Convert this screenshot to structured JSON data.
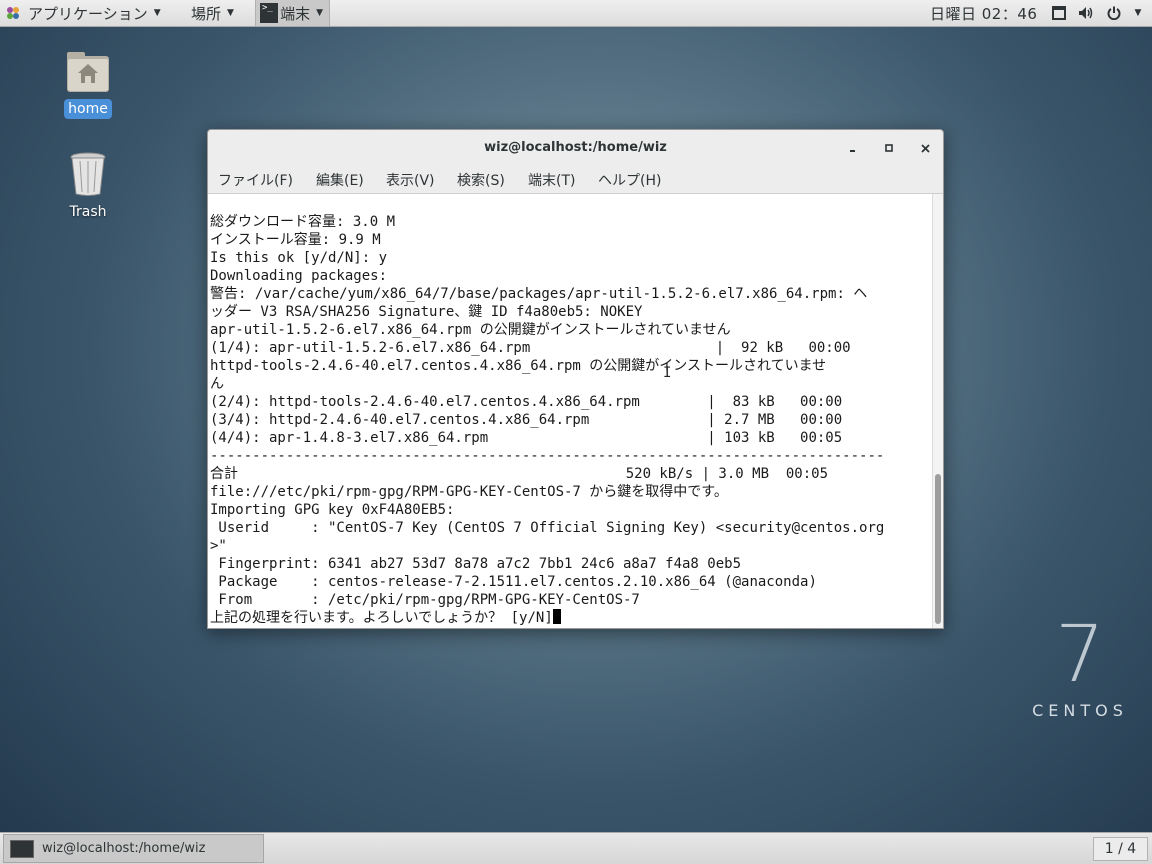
{
  "topbar": {
    "apps_label": "アプリケーション",
    "places_label": "場所",
    "active_app_label": "端末",
    "clock": "日曜日 02：46"
  },
  "desktop": {
    "home_label": "home",
    "trash_label": "Trash"
  },
  "window": {
    "title": "wiz@localhost:/home/wiz",
    "menu": [
      "ファイル(F)",
      "編集(E)",
      "表示(V)",
      "検索(S)",
      "端末(T)",
      "ヘルプ(H)"
    ],
    "lines": [
      "総ダウンロード容量: 3.0 M",
      "インストール容量: 9.9 M",
      "Is this ok [y/d/N]: y",
      "Downloading packages:",
      "警告: /var/cache/yum/x86_64/7/base/packages/apr-util-1.5.2-6.el7.x86_64.rpm: ヘ",
      "ッダー V3 RSA/SHA256 Signature、鍵 ID f4a80eb5: NOKEY",
      "apr-util-1.5.2-6.el7.x86_64.rpm の公開鍵がインストールされていません",
      "(1/4): apr-util-1.5.2-6.el7.x86_64.rpm                      |  92 kB   00:00",
      "httpd-tools-2.4.6-40.el7.centos.4.x86_64.rpm の公開鍵がインストールされていませ",
      "ん",
      "(2/4): httpd-tools-2.4.6-40.el7.centos.4.x86_64.rpm        |  83 kB   00:00",
      "(3/4): httpd-2.4.6-40.el7.centos.4.x86_64.rpm              | 2.7 MB   00:00",
      "(4/4): apr-1.4.8-3.el7.x86_64.rpm                          | 103 kB   00:05",
      "--------------------------------------------------------------------------------",
      "合計                                              520 kB/s | 3.0 MB  00:05",
      "file:///etc/pki/rpm-gpg/RPM-GPG-KEY-CentOS-7 から鍵を取得中です。",
      "Importing GPG key 0xF4A80EB5:",
      " Userid     : \"CentOS-7 Key (CentOS 7 Official Signing Key) <security@centos.org",
      ">\"",
      " Fingerprint: 6341 ab27 53d7 8a78 a7c2 7bb1 24c6 a8a7 f4a8 0eb5",
      " Package    : centos-release-7-2.1511.el7.centos.2.10.x86_64 (@anaconda)",
      " From       : /etc/pki/rpm-gpg/RPM-GPG-KEY-CentOS-7",
      "上記の処理を行います。よろしいでしょうか？ [y/N]"
    ]
  },
  "branding": {
    "number": "7",
    "word": "CENTOS"
  },
  "taskbar": {
    "task_label": "wiz@localhost:/home/wiz",
    "workspace": "1 / 4"
  }
}
